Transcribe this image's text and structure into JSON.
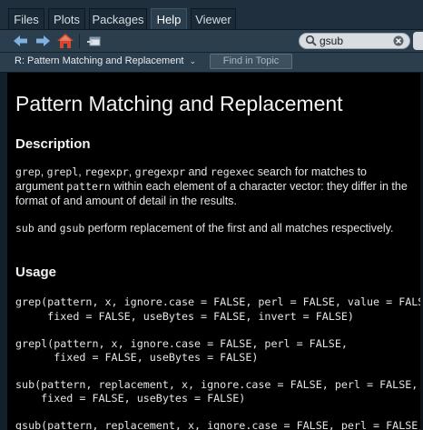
{
  "tabs": [
    {
      "label": "Files",
      "active": false
    },
    {
      "label": "Plots",
      "active": false
    },
    {
      "label": "Packages",
      "active": false
    },
    {
      "label": "Help",
      "active": true
    },
    {
      "label": "Viewer",
      "active": false
    }
  ],
  "toolbar": {
    "back_icon": "arrow-left-icon",
    "forward_icon": "arrow-right-icon",
    "home_icon": "home-icon",
    "open_window_icon": "popout-icon",
    "search_icon": "search-icon",
    "clear_icon": "clear-icon",
    "search_value": "gsub"
  },
  "topic_bar": {
    "topic": "R: Pattern Matching and Replacement",
    "find_placeholder": "Find in Topic"
  },
  "doc": {
    "title": "Pattern Matching and Replacement",
    "description_heading": "Description",
    "desc1": {
      "fn1": "grep",
      "sep1": ", ",
      "fn2": "grepl",
      "sep2": ", ",
      "fn3": "regexpr",
      "sep3": ", ",
      "fn4": "gregexpr",
      "and1": " and ",
      "fn5": "regexec",
      "text1": " search for matches to argument ",
      "arg": "pattern",
      "text2": " within each element of a character vector: they differ in the format of and amount of detail in the results."
    },
    "desc2": {
      "fn1": "sub",
      "and1": " and ",
      "fn2": "gsub",
      "text1": " perform replacement of the first and all matches respectively."
    },
    "usage_heading": "Usage",
    "usage_lines": [
      "grep(pattern, x, ignore.case = FALSE, perl = FALSE, value = FALSE,",
      "     fixed = FALSE, useBytes = FALSE, invert = FALSE)",
      "grepl(pattern, x, ignore.case = FALSE, perl = FALSE,",
      "      fixed = FALSE, useBytes = FALSE)",
      "sub(pattern, replacement, x, ignore.case = FALSE, perl = FALSE,",
      "    fixed = FALSE, useBytes = FALSE)",
      "gsub(pattern, replacement, x, ignore.case = FALSE, perl = FALSE,"
    ]
  },
  "colors": {
    "tabbar_bg": "#1f2f3d",
    "toolbar_bg": "#2b3e4e",
    "content_bg": "#000000",
    "text": "#e4e4e4",
    "home_icon_red": "#d9482b",
    "arrow_blue": "#7fb0e0"
  }
}
